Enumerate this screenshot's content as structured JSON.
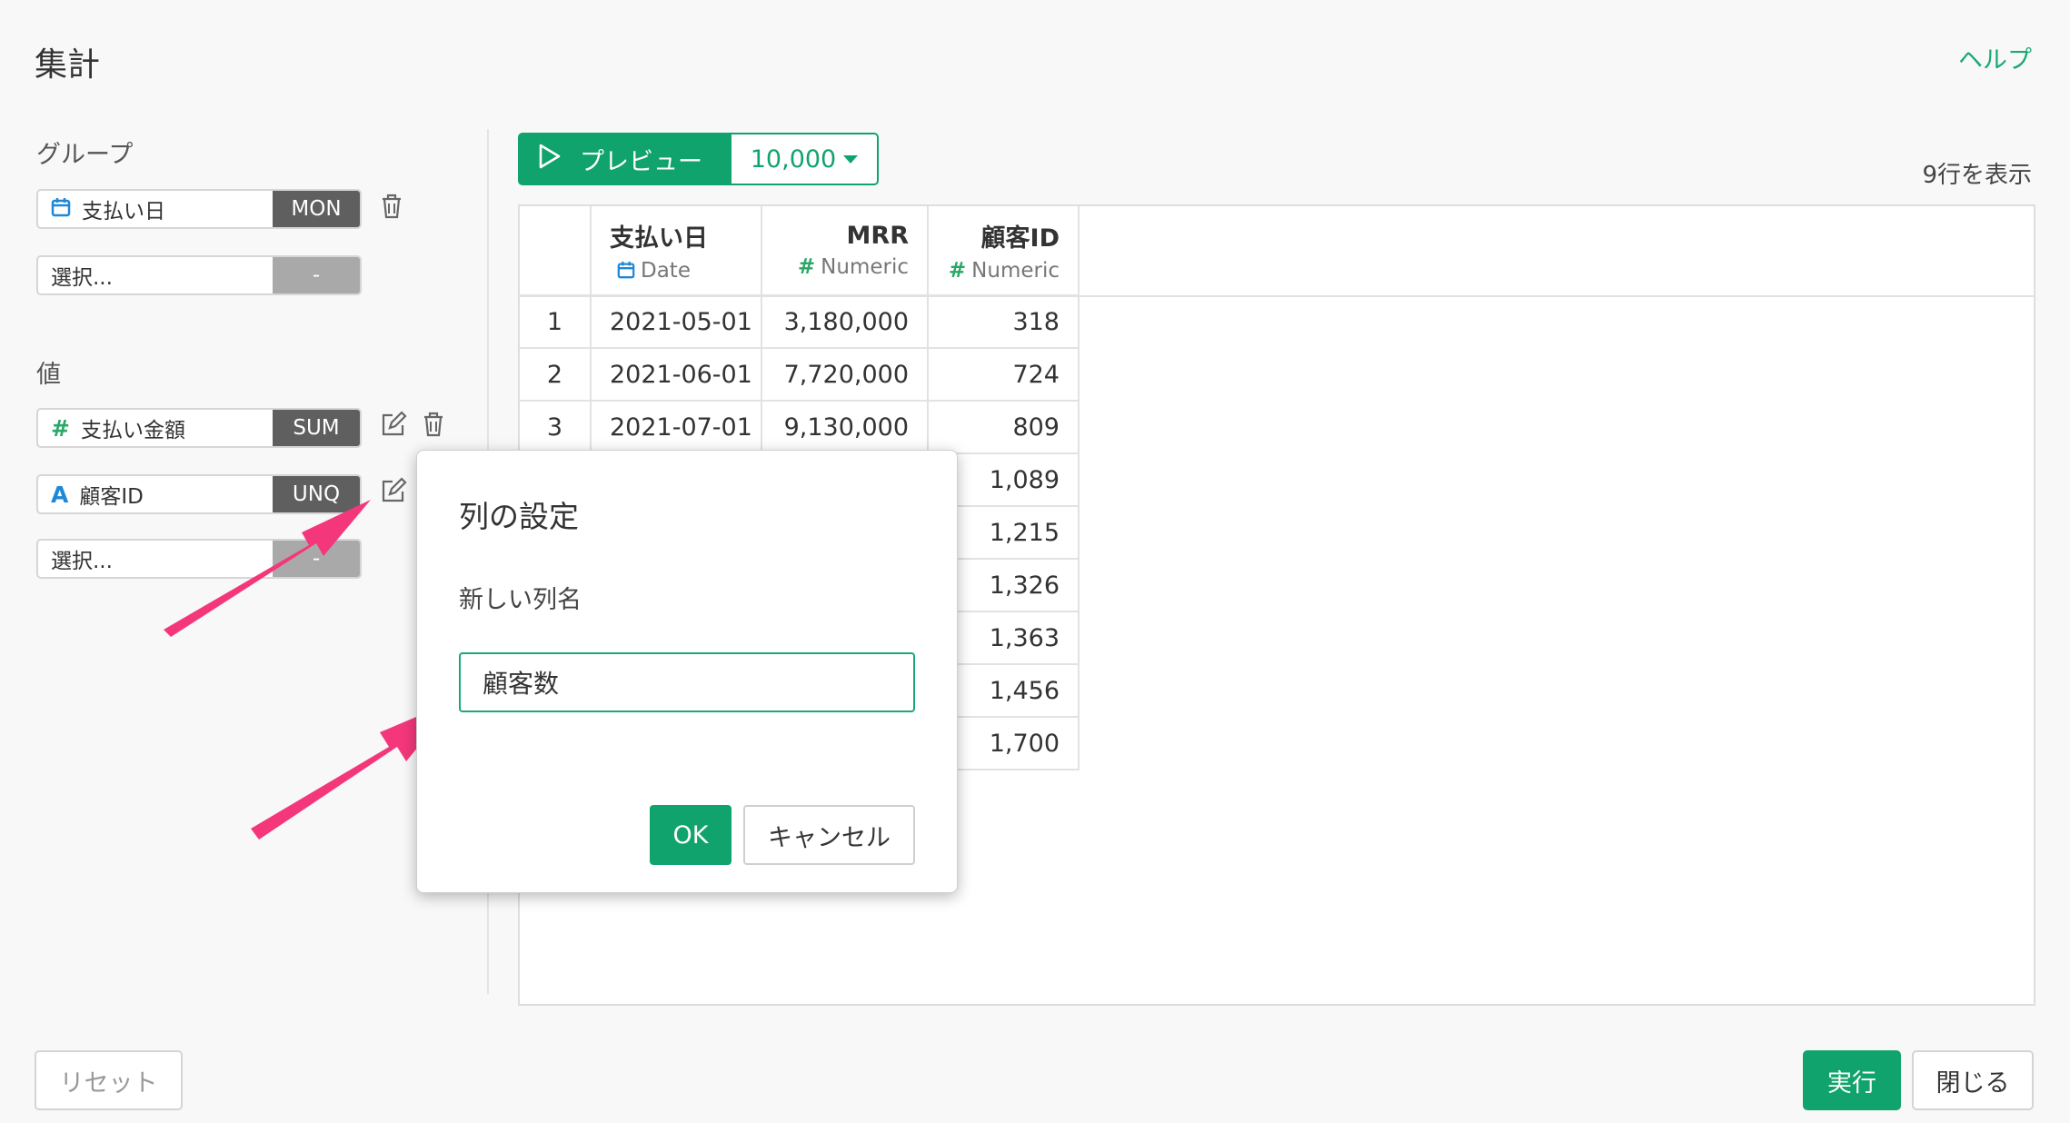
{
  "header": {
    "title": "集計",
    "help_label": "ヘルプ"
  },
  "left": {
    "group_label": "グループ",
    "group_items": [
      {
        "icon": "calendar-icon",
        "label": "支払い日",
        "tag": "MON"
      },
      {
        "label": "選択...",
        "tag": "-"
      }
    ],
    "value_label": "値",
    "value_items": [
      {
        "icon": "hash-icon",
        "label": "支払い金額",
        "tag": "SUM"
      },
      {
        "icon": "text-type-icon",
        "label": "顧客ID",
        "tag": "UNQ"
      },
      {
        "label": "選択...",
        "tag": "-"
      }
    ]
  },
  "toolbar": {
    "preview_label": "プレビュー",
    "row_limit": "10,000",
    "row_count": "9行を表示"
  },
  "table": {
    "columns": [
      {
        "name": "支払い日",
        "type": "Date"
      },
      {
        "name": "MRR",
        "type": "Numeric"
      },
      {
        "name": "顧客ID",
        "type": "Numeric"
      }
    ],
    "rows": [
      [
        "1",
        "2021-05-01",
        "3,180,000",
        "318"
      ],
      [
        "2",
        "2021-06-01",
        "7,720,000",
        "724"
      ],
      [
        "3",
        "2021-07-01",
        "9,130,000",
        "809"
      ],
      [
        "",
        "",
        "",
        "1,089"
      ],
      [
        "",
        "",
        "",
        "1,215"
      ],
      [
        "",
        "",
        "",
        "1,326"
      ],
      [
        "",
        "",
        "",
        "1,363"
      ],
      [
        "",
        "",
        "",
        "1,456"
      ],
      [
        "",
        "",
        "",
        "1,700"
      ]
    ]
  },
  "modal": {
    "title": "列の設定",
    "field_label": "新しい列名",
    "field_value": "顧客数",
    "ok_label": "OK",
    "cancel_label": "キャンセル"
  },
  "footer": {
    "reset_label": "リセット",
    "run_label": "実行",
    "close_label": "閉じる"
  },
  "colors": {
    "accent": "#11a36d",
    "arrow": "#f4377a"
  }
}
